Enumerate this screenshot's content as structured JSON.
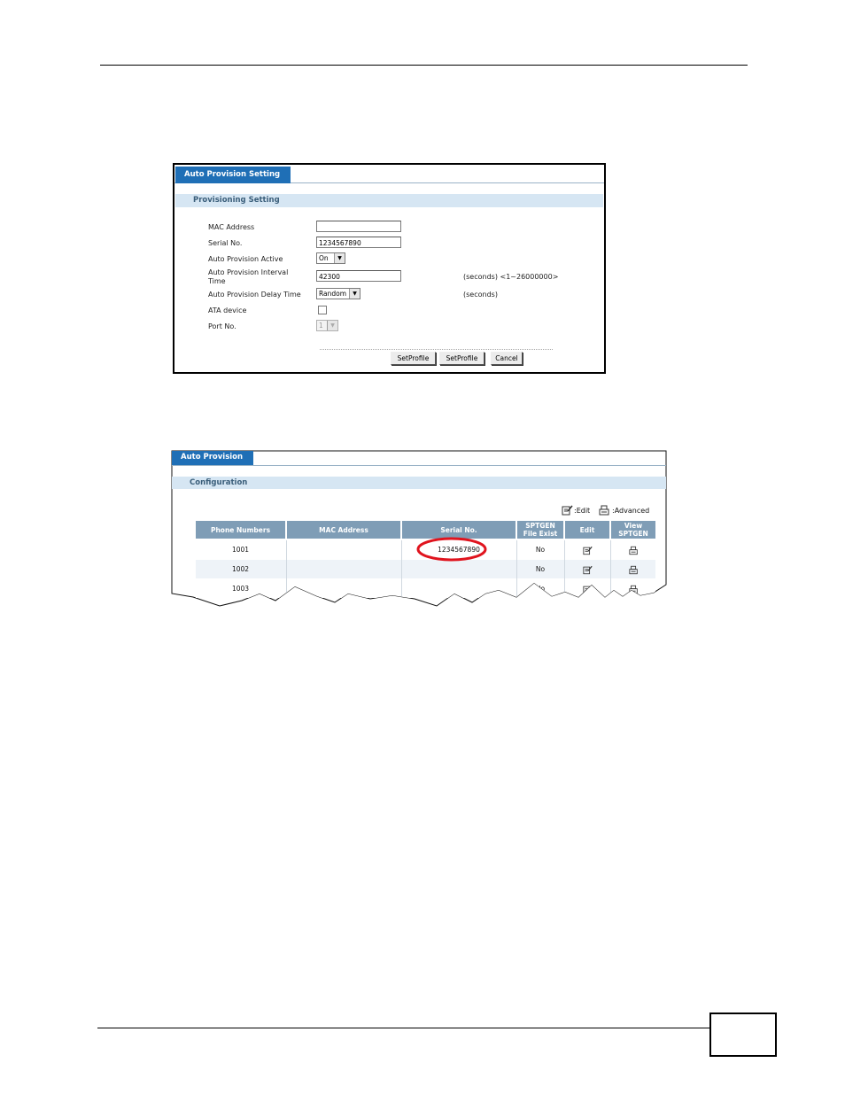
{
  "screen1": {
    "tab_label": "Auto Provision Setting",
    "section_title": "Provisioning Setting",
    "fields": {
      "mac_label": "MAC Address",
      "mac_value": "",
      "serial_label": "Serial No.",
      "serial_value": "1234567890",
      "active_label": "Auto Provision Active",
      "active_value": "On",
      "interval_label_1": "Auto Provision Interval",
      "interval_label_2": "Time",
      "interval_value": "42300",
      "interval_hint": "(seconds) <1~26000000>",
      "delay_label": "Auto Provision Delay Time",
      "delay_value": "Random",
      "delay_hint": "(seconds)",
      "ata_label": "ATA device",
      "port_label": "Port No.",
      "port_value": "1"
    },
    "buttons": {
      "setprofile1": "SetProfile",
      "setprofile2": "SetProfile",
      "cancel": "Cancel"
    }
  },
  "screen2": {
    "tab_label": "Auto Provision",
    "section_title": "Configuration",
    "legend_edit": ":Edit",
    "legend_advanced": ":Advanced",
    "headers": {
      "phone": "Phone Numbers",
      "mac": "MAC Address",
      "serial": "Serial No.",
      "sptgen_1": "SPTGEN",
      "sptgen_2": "File Exist",
      "edit": "Edit",
      "view_1": "View",
      "view_2": "SPTGEN"
    },
    "rows": [
      {
        "phone": "1001",
        "mac": "",
        "serial": "1234567890",
        "exist": "No"
      },
      {
        "phone": "1002",
        "mac": "",
        "serial": "",
        "exist": "No"
      },
      {
        "phone": "1003",
        "mac": "",
        "serial": "",
        "exist": "No"
      }
    ],
    "highlight_color": "#e0141e"
  }
}
